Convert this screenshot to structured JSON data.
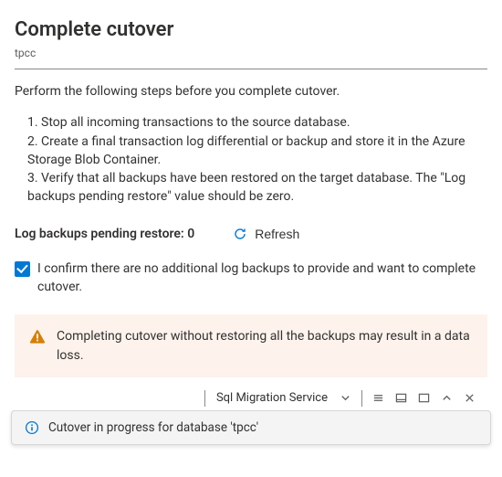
{
  "header": {
    "title": "Complete cutover",
    "subtitle": "tpcc"
  },
  "intro": "Perform the following steps before you complete cutover.",
  "steps": {
    "s1": "1. Stop all incoming transactions to the source database.",
    "s2": "2. Create a final transaction log differential or backup and store it in the Azure Storage Blob Container.",
    "s3": "3. Verify that all backups have been restored on the target database. The \"Log backups pending restore\" value should be zero."
  },
  "pending": {
    "label": "Log backups pending restore:",
    "count": "0"
  },
  "refresh_label": "Refresh",
  "confirm": {
    "checked": true,
    "text": "I confirm there are no additional log backups to provide and want to complete cutover."
  },
  "warning": {
    "text": "Completing cutover without restoring all the backups may result in a data loss."
  },
  "tabbar": {
    "title": "Sql Migration Service"
  },
  "notification": {
    "text": "Cutover in progress for database 'tpcc'"
  }
}
